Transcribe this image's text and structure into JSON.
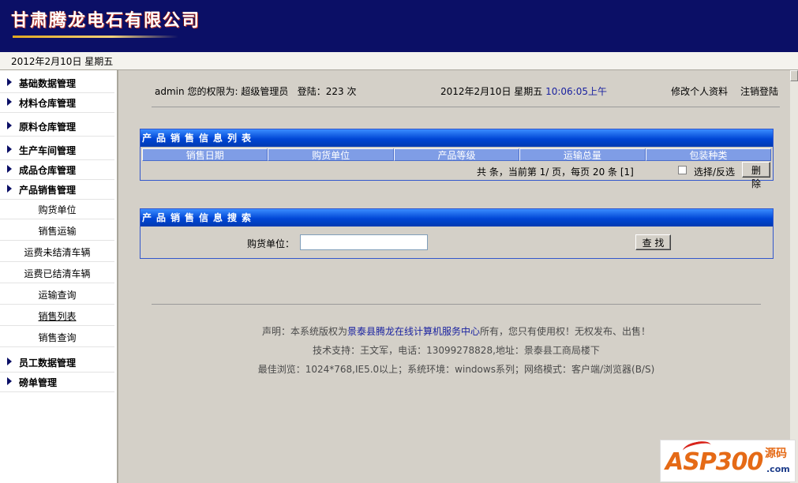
{
  "header": {
    "company_name": "甘肃腾龙电石有限公司"
  },
  "datebar": {
    "date_text": "2012年2月10日 星期五"
  },
  "sidebar": {
    "groups_top": [
      "基础数据管理",
      "材料仓库管理",
      "原料仓库管理",
      "生产车间管理",
      "成品仓库管理",
      "产品销售管理"
    ],
    "sub_items": [
      "购货单位",
      "销售运输",
      "运费未结清车辆",
      "运费已结清车辆",
      "运输查询",
      "销售列表",
      "销售查询"
    ],
    "groups_bottom": [
      "员工数据管理",
      "磅单管理"
    ]
  },
  "infobar": {
    "user": "admin",
    "permission_prefix": "您的权限为:",
    "role": "超级管理员",
    "login_text": "登陆：223 次",
    "date": "2012年2月10日 星期五",
    "time": "10:06:05上午",
    "edit_profile": "修改个人资料",
    "logout": "注销登陆"
  },
  "list_panel": {
    "title": "产品销售信息列表",
    "columns": [
      "销售日期",
      "购货单位",
      "产品等级",
      "运输总量",
      "包装种类"
    ],
    "pager_text": "共 条，当前第 1/ 页，每页 20 条 [1]",
    "select_label": "选择/反选",
    "delete_button": "删除"
  },
  "search_panel": {
    "title": "产品销售信息搜索",
    "field_label": "购货单位：",
    "field_value": "",
    "search_button": "查 找"
  },
  "footer": {
    "line1_prefix": "声明：本系统版权为",
    "line1_link": "景泰县腾龙在线计算机服务中心",
    "line1_suffix": "所有，您只有使用权！无权发布、出售！",
    "line2": "技术支持：王文军，电话：13099278828,地址：景泰县工商局楼下",
    "line3": "最佳浏览：1024*768,IE5.0以上；系统环境：windows系列；网络模式：客户端/浏览器(B/S)"
  },
  "watermark": {
    "logo_text": "ASP300",
    "logo_cn": "源码",
    "logo_domain": ".com"
  },
  "colors": {
    "header_bg": "#0b0f66",
    "panel_title": "#0046d5",
    "table_header": "#7f9de6"
  }
}
